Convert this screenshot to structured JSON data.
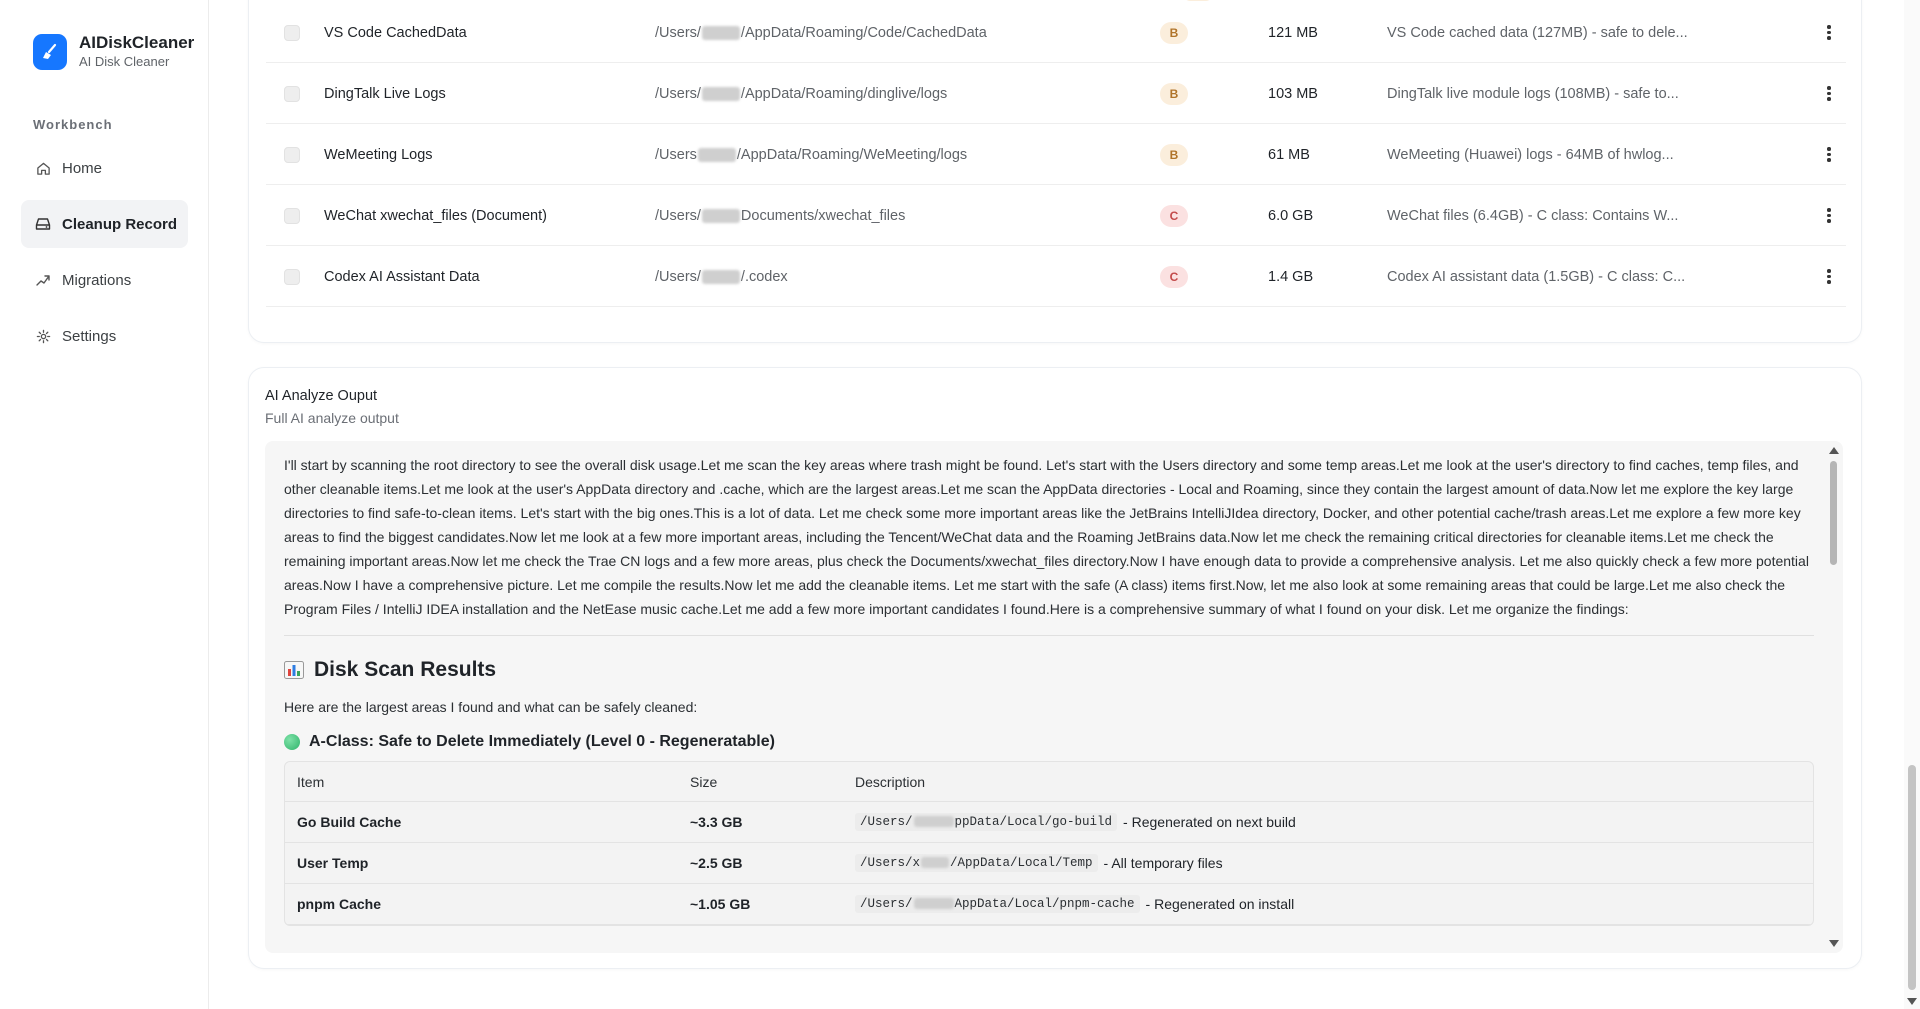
{
  "app": {
    "name": "AIDiskCleaner",
    "subtitle": "AI Disk Cleaner",
    "accent": "#1677ff"
  },
  "sidebar": {
    "section": "Workbench",
    "items": [
      {
        "label": "Home",
        "icon": "home-icon"
      },
      {
        "label": "Cleanup Record",
        "icon": "hard-drive-icon",
        "active": true
      },
      {
        "label": "Migrations",
        "icon": "migration-icon"
      },
      {
        "label": "Settings",
        "icon": "gear-icon"
      }
    ]
  },
  "records": [
    {
      "name": "VS Code CachedData",
      "path_pre": "/Users/",
      "path_post": "/AppData/Roaming/Code/CachedData",
      "class": "B",
      "size": "121 MB",
      "desc": "VS Code cached data (127MB) - safe to dele..."
    },
    {
      "name": "DingTalk Live Logs",
      "path_pre": "/Users/",
      "path_post": "/AppData/Roaming/dinglive/logs",
      "class": "B",
      "size": "103 MB",
      "desc": "DingTalk live module logs (108MB) - safe to..."
    },
    {
      "name": "WeMeeting Logs",
      "path_pre": "/Users",
      "path_post": "/AppData/Roaming/WeMeeting/logs",
      "class": "B",
      "size": "61 MB",
      "desc": "WeMeeting (Huawei) logs - 64MB of hwlog..."
    },
    {
      "name": "WeChat xwechat_files (Document)",
      "path_pre": "/Users/",
      "path_post": "Documents/xwechat_files",
      "class": "C",
      "size": "6.0 GB",
      "desc": "WeChat files (6.4GB) - C class: Contains W..."
    },
    {
      "name": "Codex AI Assistant Data",
      "path_pre": "/Users/",
      "path_post": "/.codex",
      "class": "C",
      "size": "1.4 GB",
      "desc": "Codex AI assistant data (1.5GB) - C class: C..."
    }
  ],
  "output": {
    "title": "AI Analyze Ouput",
    "subtitle": "Full AI analyze output",
    "paragraph": "I'll start by scanning the root directory to see the overall disk usage.Let me scan the key areas where trash might be found. Let's start with the Users directory and some temp areas.Let me look at the user's directory to find caches, temp files, and other cleanable items.Let me look at the user's AppData directory and .cache, which are the largest areas.Let me scan the AppData directories - Local and Roaming, since they contain the largest amount of data.Now let me explore the key large directories to find safe-to-clean items. Let's start with the big ones.This is a lot of data. Let me check some more important areas like the JetBrains IntelliJIdea directory, Docker, and other potential cache/trash areas.Let me explore a few more key areas to find the biggest candidates.Now let me look at a few more important areas, including the Tencent/WeChat data and the Roaming JetBrains data.Now let me check the remaining critical directories for cleanable items.Let me check the remaining important areas.Now let me check the Trae CN logs and a few more areas, plus check the Documents/xwechat_files directory.Now I have enough data to provide a comprehensive analysis. Let me also quickly check a few more potential areas.Now I have a comprehensive picture. Let me compile the results.Now let me add the cleanable items. Let me start with the safe (A class) items first.Now, let me also look at some remaining areas that could be large.Let me also check the Program Files / IntelliJ IDEA installation and the NetEase music cache.Let me add a few more important candidates I found.Here is a comprehensive summary of what I found on your disk. Let me organize the findings:",
    "heading": "Disk Scan Results",
    "intro": "Here are the largest areas I found and what can be safely cleaned:",
    "subheading": "A-Class: Safe to Delete Immediately (Level 0 - Regeneratable)",
    "table_headers": [
      "Item",
      "Size",
      "Description"
    ],
    "table_rows": [
      {
        "item": "Go Build Cache",
        "size": "~3.3 GB",
        "code_pre": "/Users/",
        "code_post": "ppData/Local/go-build",
        "note": "- Regenerated on next build"
      },
      {
        "item": "User Temp",
        "size": "~2.5 GB",
        "code_pre": "/Users/x",
        "code_post": "/AppData/Local/Temp",
        "note": "- All temporary files"
      },
      {
        "item": "pnpm Cache",
        "size": "~1.05 GB",
        "code_pre": "/Users/",
        "code_post": "AppData/Local/pnpm-cache",
        "note": "- Regenerated on install"
      }
    ]
  }
}
